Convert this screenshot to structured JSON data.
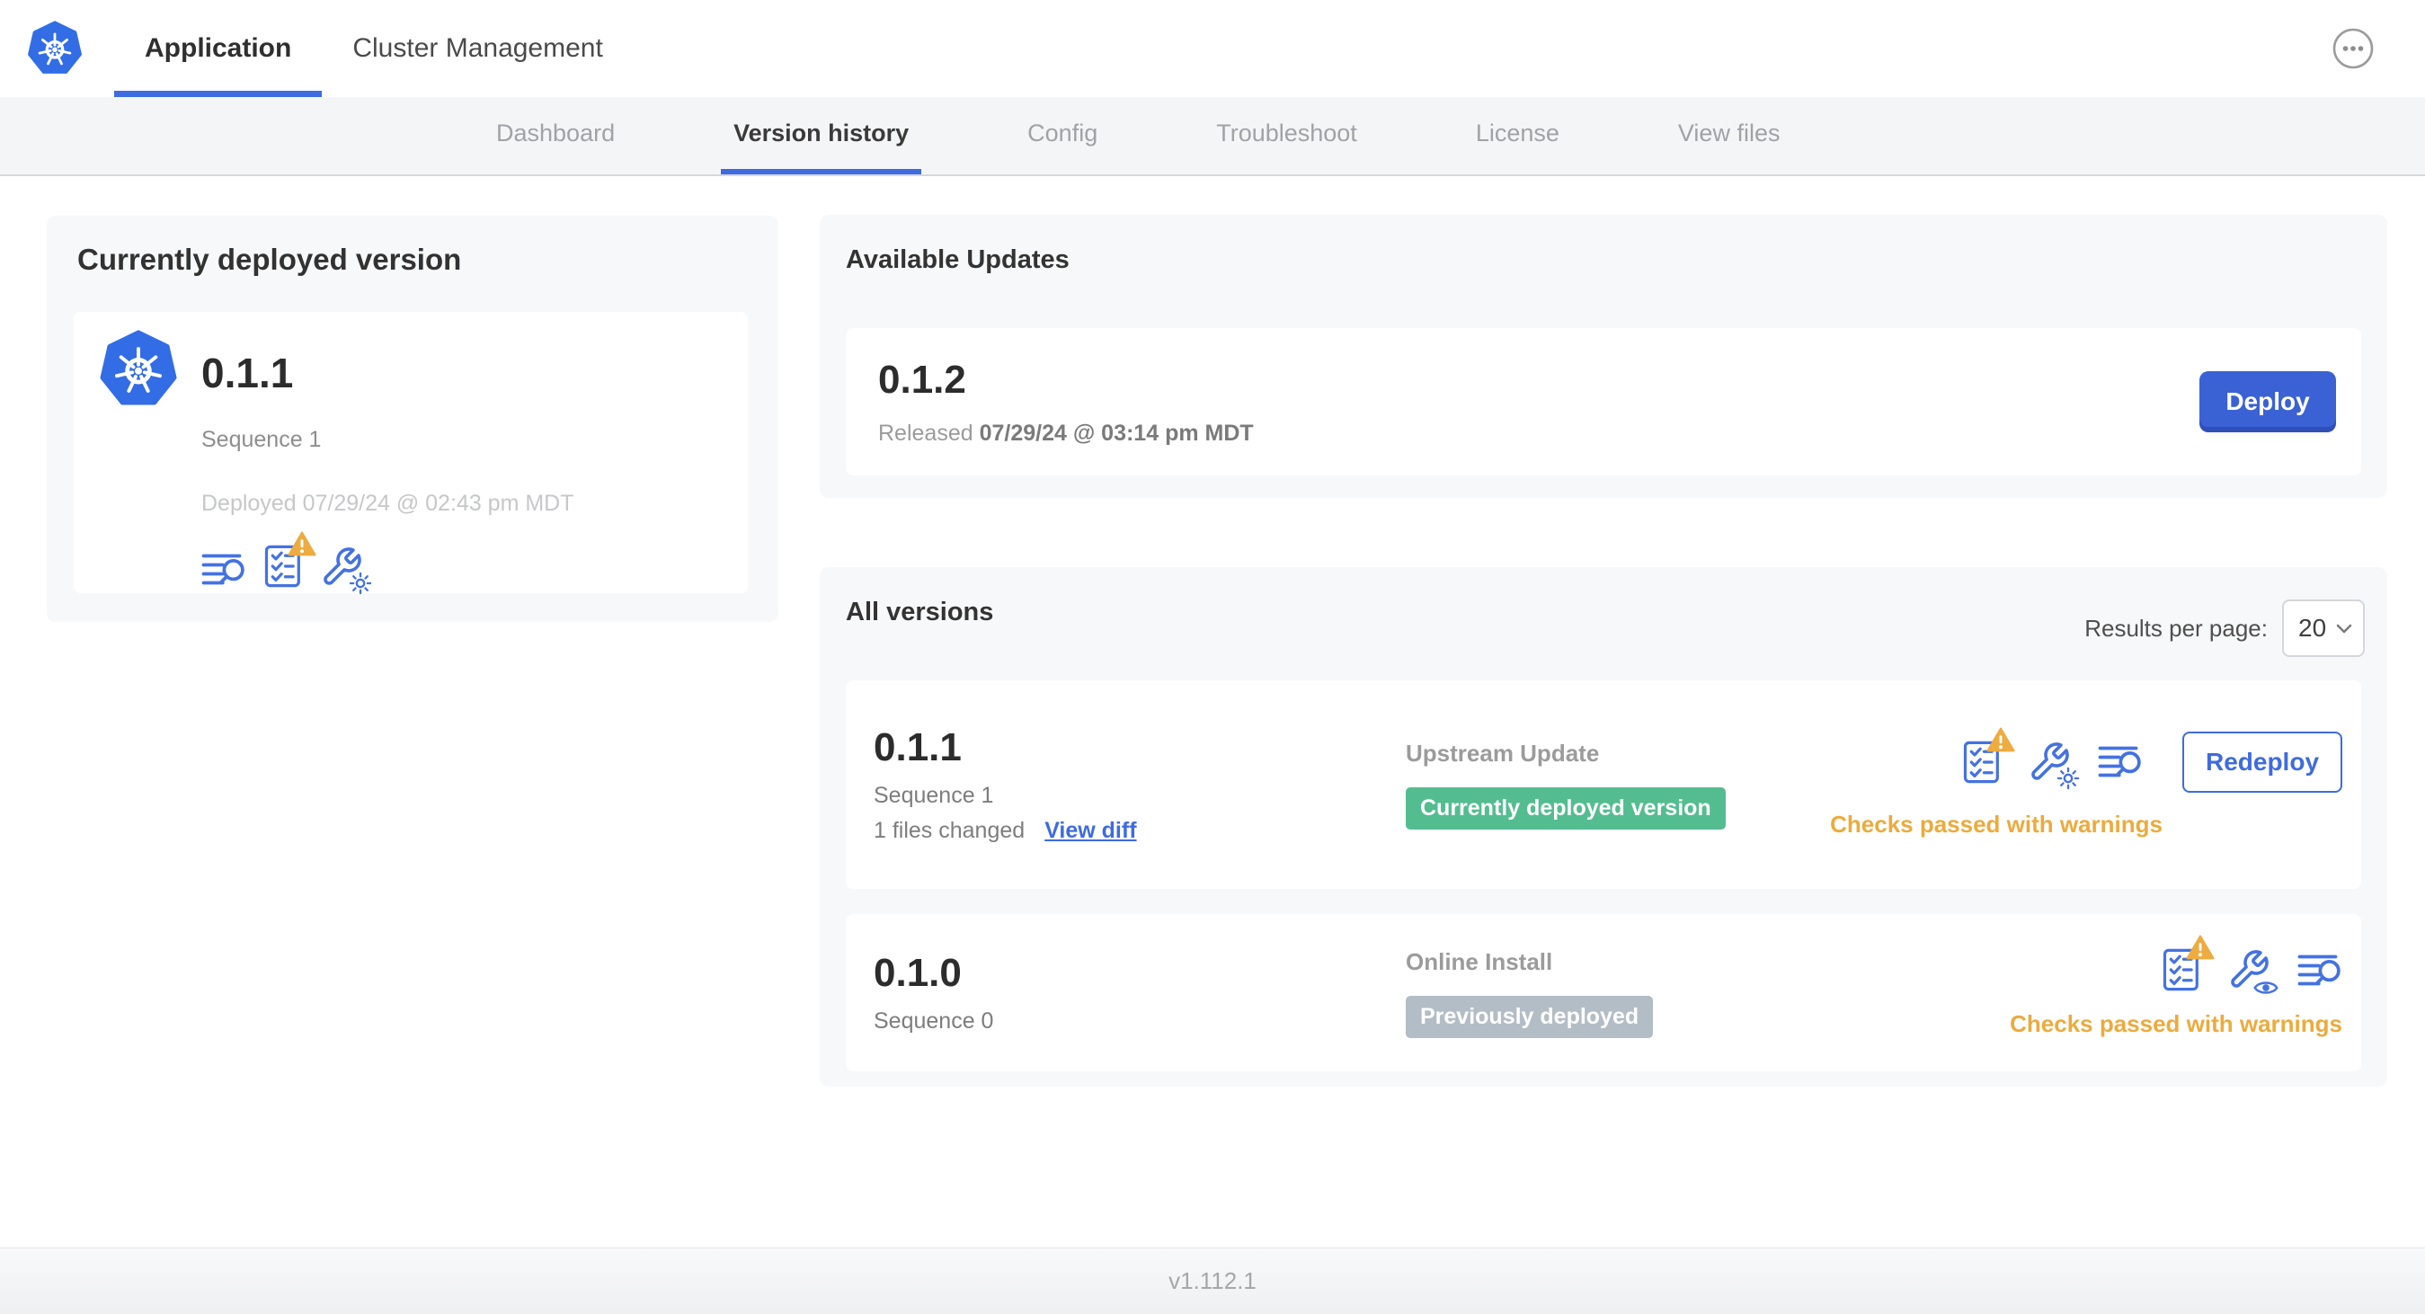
{
  "header": {
    "tabs": [
      {
        "label": "Application",
        "active": true
      },
      {
        "label": "Cluster Management",
        "active": false
      }
    ]
  },
  "nav": {
    "tabs": [
      {
        "label": "Dashboard",
        "active": false
      },
      {
        "label": "Version history",
        "active": true
      },
      {
        "label": "Config",
        "active": false
      },
      {
        "label": "Troubleshoot",
        "active": false
      },
      {
        "label": "License",
        "active": false
      },
      {
        "label": "View files",
        "active": false
      }
    ]
  },
  "current": {
    "title": "Currently deployed version",
    "version": "0.1.1",
    "sequence": "Sequence 1",
    "deployed": "Deployed 07/29/24 @ 02:43 pm MDT",
    "icons": [
      "release-notes",
      "preflight-checks-warning",
      "edit-config"
    ]
  },
  "updates": {
    "title": "Available Updates",
    "version": "0.1.2",
    "released_prefix": "Released",
    "released_date": "07/29/24 @ 03:14 pm MDT",
    "deploy_label": "Deploy"
  },
  "all_versions": {
    "title": "All versions",
    "results_label": "Results per page:",
    "results_value": "20",
    "rows": [
      {
        "version": "0.1.1",
        "sequence": "Sequence 1",
        "files_changed": "1 files changed",
        "view_diff": "View diff",
        "source": "Upstream Update",
        "badge": "Currently deployed version",
        "badge_type": "green",
        "icons": [
          "preflight-checks-warning",
          "edit-config",
          "release-notes"
        ],
        "status": "Checks passed with warnings",
        "action_label": "Redeploy"
      },
      {
        "version": "0.1.0",
        "sequence": "Sequence 0",
        "source": "Online Install",
        "badge": "Previously deployed",
        "badge_type": "gray",
        "icons": [
          "preflight-checks-warning",
          "view-config",
          "release-notes"
        ],
        "status": "Checks passed with warnings"
      }
    ]
  },
  "footer": {
    "version": "v1.112.1"
  },
  "colors": {
    "accent_blue": "#3f6be0",
    "icon_blue": "#4472e2",
    "kubernetes_blue": "#326de6",
    "deploy_button": "#3a62d4",
    "green_badge": "#54bd90",
    "gray_badge": "#b3bdc5",
    "warning_amber": "#ecab3d",
    "nav_bg": "#f4f5f7",
    "card_bg": "#f7f8f9"
  }
}
